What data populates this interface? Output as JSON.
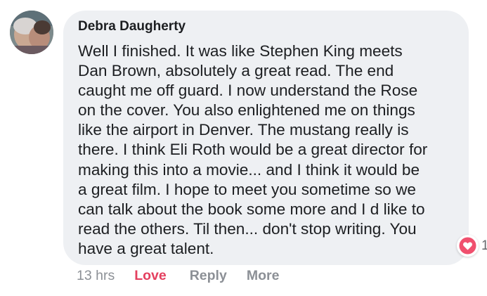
{
  "comment": {
    "author": "Debra Daugherty",
    "text": "Well I finished. It was like Stephen King meets\nDan Brown, absolutely a great read. The end\ncaught me off guard. I now understand the Rose\non the cover. You also enlightened me on things\nlike the airport in Denver. The mustang really is\nthere. I think Eli Roth would be a great director for\nmaking this into a movie... and I think it would be\na great film. I hope to meet you sometime so we\ncan talk about the book some more and I d like to\nread the others. Til then... don't stop writing. You\nhave a great talent.",
    "timestamp": "13 hrs",
    "reaction_count": "1",
    "reaction_icon": "heart-icon"
  },
  "actions": {
    "love_label": "Love",
    "reply_label": "Reply",
    "more_label": "More"
  },
  "colors": {
    "bubble": "#eef0f3",
    "love": "#e4405f",
    "muted": "#8c9096"
  }
}
